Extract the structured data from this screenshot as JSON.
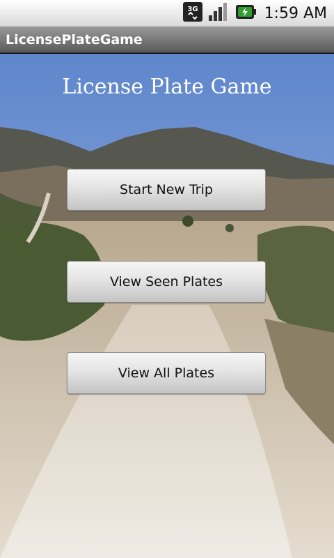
{
  "status_bar": {
    "network_label": "3G",
    "time": "1:59 AM",
    "icons": [
      "3g-data-icon",
      "signal-strength-icon",
      "battery-charging-icon"
    ]
  },
  "app_bar": {
    "title": "LicensePlateGame"
  },
  "main": {
    "headline": "License Plate Game",
    "buttons": [
      {
        "label": "Start New Trip"
      },
      {
        "label": "View Seen Plates"
      },
      {
        "label": "View All Plates"
      }
    ]
  },
  "colors": {
    "title_bar": "#6e6e6e",
    "sky": "#6f94d6",
    "road": "#d9d1c4"
  }
}
